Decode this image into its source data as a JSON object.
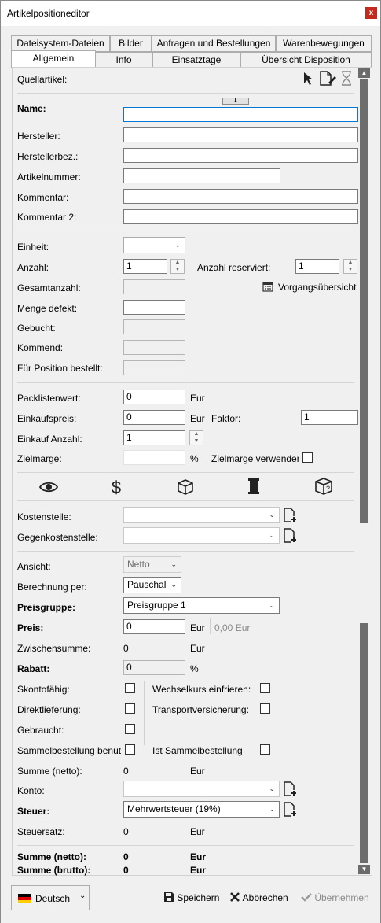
{
  "window": {
    "title": "Artikelpositioneditor",
    "close": "x"
  },
  "tabs_row1": [
    "Dateisystem-Dateien",
    "Bilder",
    "Anfragen und Bestellungen",
    "Warenbewegungen"
  ],
  "tabs_row2": [
    "Allgemein",
    "Info",
    "Einsatztage",
    "Übersicht Disposition"
  ],
  "form": {
    "quellartikel": "Quellartikel:",
    "name": "Name:",
    "name_value": "",
    "hersteller": "Hersteller:",
    "herstellerbez": "Herstellerbez.:",
    "artikelnummer": "Artikelnummer:",
    "kommentar": "Kommentar:",
    "kommentar2": "Kommentar 2:",
    "einheit": "Einheit:",
    "anzahl": "Anzahl:",
    "anzahl_value": "1",
    "anzahl_reserviert": "Anzahl reserviert:",
    "anzahl_reserviert_value": "1",
    "gesamtanzahl": "Gesamtanzahl:",
    "vorgangsuebersicht": "Vorgangsübersicht",
    "menge_defekt": "Menge defekt:",
    "gebucht": "Gebucht:",
    "kommend": "Kommend:",
    "fuer_position": "Für Position bestellt:",
    "packlistenwert": "Packlistenwert:",
    "packlistenwert_value": "0",
    "eur": "Eur",
    "einkaufspreis": "Einkaufspreis:",
    "einkaufspreis_value": "0",
    "faktor": "Faktor:",
    "faktor_value": "1",
    "einkauf_anzahl": "Einkauf Anzahl:",
    "einkauf_anzahl_value": "1",
    "zielmarge": "Zielmarge:",
    "percent": "%",
    "zielmarge_verwenden": "Zielmarge verwenden",
    "kostenstelle": "Kostenstelle:",
    "gegenkostenstelle": "Gegenkostenstelle:",
    "ansicht": "Ansicht:",
    "ansicht_value": "Netto",
    "berechnung": "Berechnung per:",
    "berechnung_value": "Pauschal",
    "preisgruppe": "Preisgruppe:",
    "preisgruppe_value": "Preisgruppe 1",
    "preis": "Preis:",
    "preis_value": "0",
    "preis_eur": "0,00 Eur",
    "zwischensumme": "Zwischensumme:",
    "zwischensumme_value": "0",
    "rabatt": "Rabatt:",
    "rabatt_value": "0",
    "skontofaehig": "Skontofähig:",
    "wechselkurs": "Wechselkurs einfrieren:",
    "direktlieferung": "Direktlieferung:",
    "transportversicherung": "Transportversicherung:",
    "gebraucht": "Gebraucht:",
    "sammelbestellung_benutzen": "Sammelbestellung benutzen",
    "ist_sammelbestellung": "Ist Sammelbestellung",
    "summe_netto": "Summe (netto):",
    "summe_netto_value": "0",
    "konto": "Konto:",
    "steuer": "Steuer:",
    "steuer_value": "Mehrwertsteuer (19%)",
    "steuersatz": "Steuersatz:",
    "steuersatz_value": "0",
    "total_netto": "Summe (netto):",
    "total_netto_value": "0",
    "total_brutto": "Summe (brutto):",
    "total_brutto_value": "0"
  },
  "footer": {
    "language": "Deutsch",
    "save": "Speichern",
    "cancel": "Abbrechen",
    "apply": "Übernehmen"
  },
  "colors": {
    "accent": "#0078d7",
    "close": "#c42b1c",
    "scrollbar": "#6d6d6d"
  }
}
